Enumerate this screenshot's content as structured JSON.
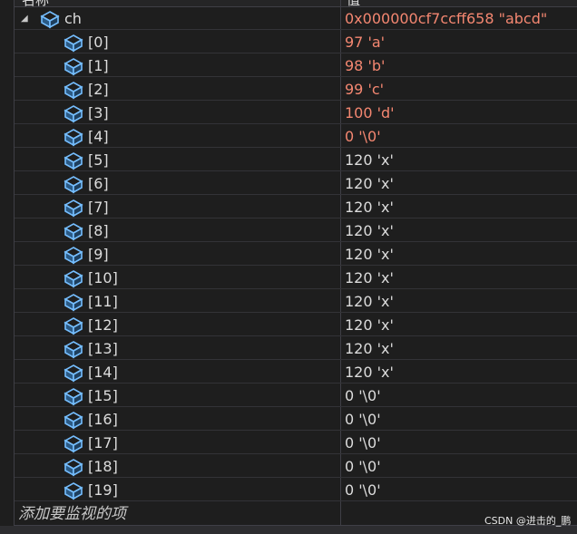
{
  "header": {
    "name_col": "名称",
    "value_col": "值"
  },
  "root": {
    "name": "ch",
    "value": "0x000000cf7ccff658 \"abcd\"",
    "expander_icon": "triangle-expanded-icon",
    "icon": "object-cube-icon"
  },
  "items": [
    {
      "name": "[0]",
      "value": "97 'a'",
      "changed": true
    },
    {
      "name": "[1]",
      "value": "98 'b'",
      "changed": true
    },
    {
      "name": "[2]",
      "value": "99 'c'",
      "changed": true
    },
    {
      "name": "[3]",
      "value": "100 'd'",
      "changed": true
    },
    {
      "name": "[4]",
      "value": "0 '\\0'",
      "changed": true
    },
    {
      "name": "[5]",
      "value": "120 'x'",
      "changed": false
    },
    {
      "name": "[6]",
      "value": "120 'x'",
      "changed": false
    },
    {
      "name": "[7]",
      "value": "120 'x'",
      "changed": false
    },
    {
      "name": "[8]",
      "value": "120 'x'",
      "changed": false
    },
    {
      "name": "[9]",
      "value": "120 'x'",
      "changed": false
    },
    {
      "name": "[10]",
      "value": "120 'x'",
      "changed": false
    },
    {
      "name": "[11]",
      "value": "120 'x'",
      "changed": false
    },
    {
      "name": "[12]",
      "value": "120 'x'",
      "changed": false
    },
    {
      "name": "[13]",
      "value": "120 'x'",
      "changed": false
    },
    {
      "name": "[14]",
      "value": "120 'x'",
      "changed": false
    },
    {
      "name": "[15]",
      "value": "0 '\\0'",
      "changed": false
    },
    {
      "name": "[16]",
      "value": "0 '\\0'",
      "changed": false
    },
    {
      "name": "[17]",
      "value": "0 '\\0'",
      "changed": false
    },
    {
      "name": "[18]",
      "value": "0 '\\0'",
      "changed": false
    },
    {
      "name": "[19]",
      "value": "0 '\\0'",
      "changed": false
    }
  ],
  "add_watch_placeholder": "添加要监视的项",
  "watermark": "CSDN @进击的_鹏",
  "colors": {
    "background": "#1e1e1e",
    "changed_value": "#f48771",
    "normal_value": "#dcdcdc",
    "icon_blue": "#75beff"
  }
}
